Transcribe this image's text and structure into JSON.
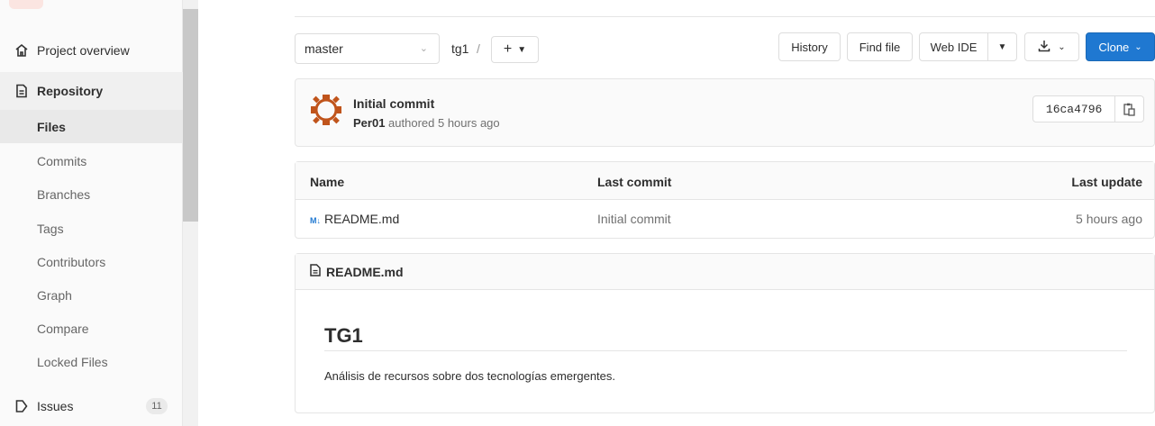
{
  "sidebar": {
    "overview_label": "Project overview",
    "repository_label": "Repository",
    "sub_items": [
      "Files",
      "Commits",
      "Branches",
      "Tags",
      "Contributors",
      "Graph",
      "Compare",
      "Locked Files"
    ],
    "issues_label": "Issues",
    "issues_count": "11"
  },
  "toolbar": {
    "branch": "master",
    "path_root": "tg1",
    "path_sep": "/",
    "history": "History",
    "find_file": "Find file",
    "web_ide": "Web IDE",
    "clone": "Clone"
  },
  "commit": {
    "title": "Initial commit",
    "author": "Per01",
    "meta": "authored 5 hours ago",
    "sha": "16ca4796"
  },
  "table": {
    "headers": [
      "Name",
      "Last commit",
      "Last update"
    ],
    "rows": [
      {
        "name": "README.md",
        "last_commit": "Initial commit",
        "last_update": "5 hours ago"
      }
    ]
  },
  "readme": {
    "filename": "README.md",
    "heading": "TG1",
    "body": "Análisis de recursos sobre dos tecnologías emergentes."
  },
  "colors": {
    "accent": "#1f78d1"
  }
}
